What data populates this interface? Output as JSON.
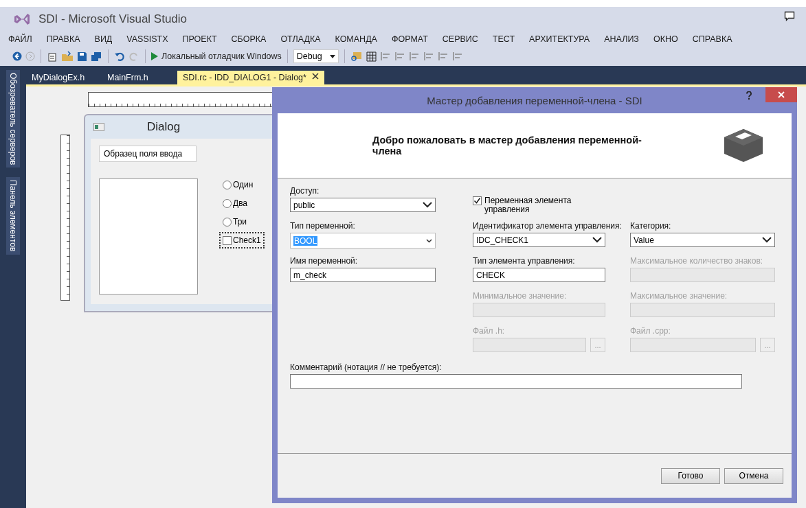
{
  "window": {
    "title": "SDI - Microsoft Visual Studio"
  },
  "menu": [
    "ФАЙЛ",
    "ПРАВКА",
    "ВИД",
    "VASSISTX",
    "ПРОЕКТ",
    "СБОРКА",
    "ОТЛАДКА",
    "КОМАНДА",
    "ФОРМАТ",
    "СЕРВИС",
    "ТЕСТ",
    "АРХИТЕКТУРА",
    "АНАЛИЗ",
    "ОКНО",
    "СПРАВКА"
  ],
  "toolbar": {
    "debugger": "Локальный отладчик Windows",
    "configuration": "Debug"
  },
  "side_tabs": [
    "Обозреватель серверов",
    "Панель элементов"
  ],
  "doc_tabs": [
    {
      "label": "MyDialogEx.h",
      "selected": false
    },
    {
      "label": "MainFrm.h",
      "selected": false
    },
    {
      "label": "SDI.rc - IDD_DIALOG1 - Dialog*",
      "selected": true
    }
  ],
  "designer": {
    "dialog_title": "Dialog",
    "edit_text": "Образец поля ввода",
    "radios": [
      {
        "label": "Один",
        "selected": false
      },
      {
        "label": "Два",
        "selected": false
      },
      {
        "label": "Три",
        "selected": false
      }
    ],
    "checkbox": {
      "label": "Check1",
      "checked": false
    }
  },
  "wizard": {
    "title": "Мастер добавления переменной-члена - SDI",
    "heading": "Добро пожаловать в мастер добавления переменной-члена",
    "rows": [
      [
        {
          "kind": "dropdown",
          "label": "Доступ:",
          "value": "public",
          "disabled": false
        },
        {
          "kind": "checkbox",
          "label": "Переменная элемента управления",
          "checked": true
        },
        null
      ],
      [
        {
          "kind": "combo",
          "label": "Тип переменной:",
          "value": "BOOL",
          "disabled": false
        },
        {
          "kind": "dropdown",
          "label": "Идентификатор элемента управления:",
          "value": "IDC_CHECK1",
          "disabled": false
        },
        {
          "kind": "dropdown",
          "label": "Категория:",
          "value": "Value",
          "disabled": false
        }
      ],
      [
        {
          "kind": "text",
          "label": "Имя переменной:",
          "value": "m_check",
          "disabled": false
        },
        {
          "kind": "text",
          "label": "Тип элемента управления:",
          "value": "CHECK",
          "disabled": false
        },
        {
          "kind": "text",
          "label": "Максимальное количество знаков:",
          "disabled": true
        }
      ],
      [
        null,
        {
          "kind": "text",
          "label": "Минимальное значение:",
          "disabled": true
        },
        {
          "kind": "text",
          "label": "Максимальное значение:",
          "disabled": true
        }
      ],
      [
        null,
        {
          "kind": "browse",
          "label": "Файл .h:",
          "button": "...",
          "disabled": true
        },
        {
          "kind": "browse",
          "label": "Файл .cpp:",
          "button": "...",
          "disabled": true
        }
      ]
    ],
    "comment": {
      "label": "Комментарий (нотация // не требуется):"
    },
    "buttons": [
      "Готово",
      "Отмена"
    ]
  }
}
